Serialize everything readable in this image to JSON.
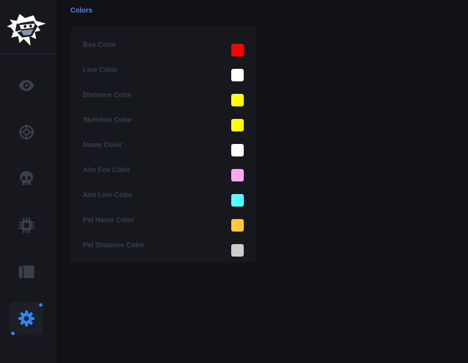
{
  "page": {
    "section_title": "Colors"
  },
  "sidebar": {
    "items": [
      {
        "icon": "eye-icon",
        "active": false
      },
      {
        "icon": "crosshair-icon",
        "active": false
      },
      {
        "icon": "skull-icon",
        "active": false
      },
      {
        "icon": "chip-icon",
        "active": false
      },
      {
        "icon": "folder-icon",
        "active": false
      },
      {
        "icon": "gear-icon",
        "active": true
      }
    ],
    "accent_color": "#2f86f5",
    "icon_color": "#3b3f48"
  },
  "colors": {
    "rows": [
      {
        "label": "Box Color",
        "color": "#ff0000"
      },
      {
        "label": "Line Color",
        "color": "#ffffff"
      },
      {
        "label": "Distance Color",
        "color": "#ffff00"
      },
      {
        "label": "Skeleton Color",
        "color": "#ffff00"
      },
      {
        "label": "Name Color",
        "color": "#ffffff"
      },
      {
        "label": "Aim Fov Color",
        "color": "#ffaaf0"
      },
      {
        "label": "Aim Line Color",
        "color": "#55ffff"
      },
      {
        "label": "Pal Name Color",
        "color": "#ffc83c"
      },
      {
        "label": "Pal Distance Color",
        "color": "#cdcdcd"
      }
    ]
  }
}
